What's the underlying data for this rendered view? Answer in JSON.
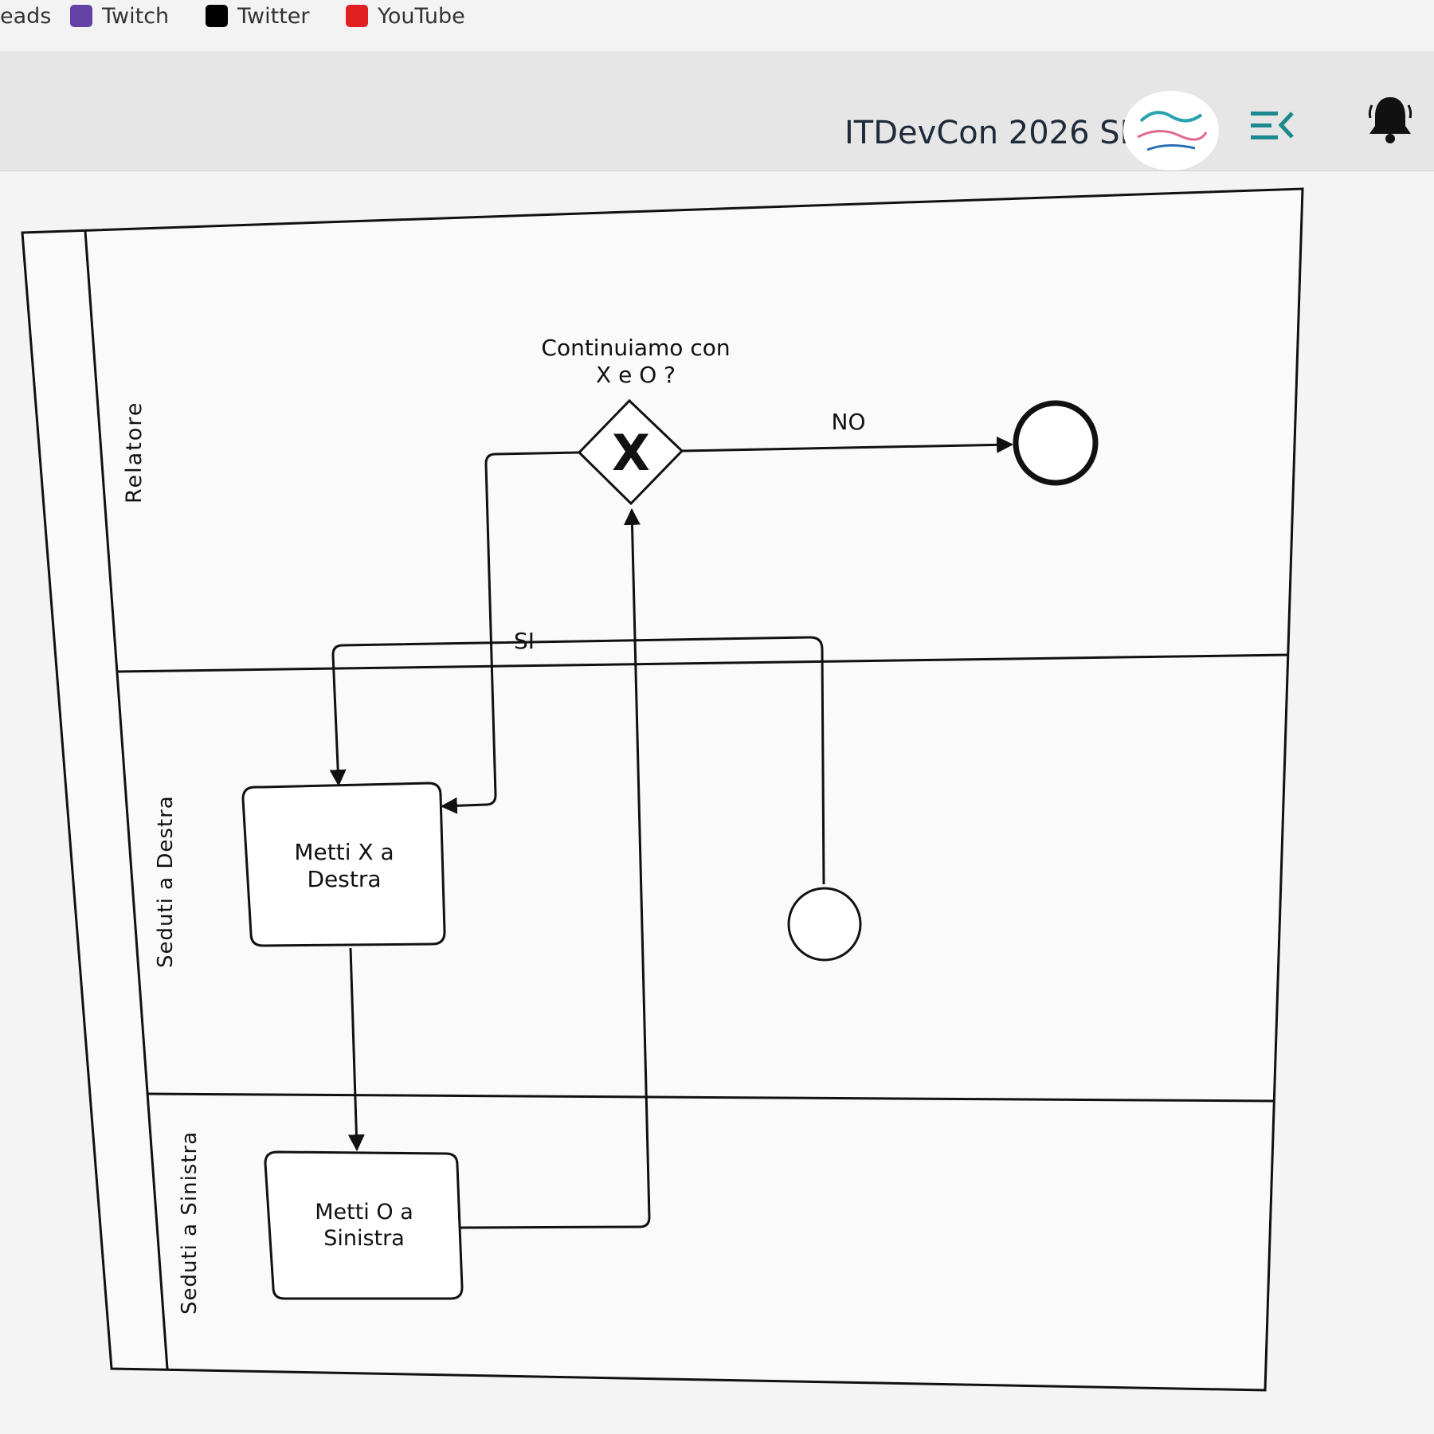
{
  "bookmarks": [
    {
      "label": "eads",
      "color": ""
    },
    {
      "label": "Twitch",
      "color": "#6441a5"
    },
    {
      "label": "Twitter",
      "color": "#000000"
    },
    {
      "label": "YouTube",
      "color": "#e02020"
    }
  ],
  "header": {
    "event_title": "ITDevCon 2026 SE",
    "menu_icon": "menu-collapse-icon",
    "bell_icon": "bell-icon",
    "accent_color": "#1b8a8f"
  },
  "diagram": {
    "lanes": [
      {
        "label": "Relatore"
      },
      {
        "label": "Seduti a Destra"
      },
      {
        "label": "Seduti a Sinistra"
      }
    ],
    "gateway": {
      "label_line1": "Continuiamo con",
      "label_line2": "X e O ?",
      "marker": "X"
    },
    "flow_labels": {
      "no": "NO",
      "si": "SI"
    },
    "tasks": [
      {
        "line1": "Metti X a",
        "line2": "Destra"
      },
      {
        "line1": "Metti O a",
        "line2": "Sinistra"
      }
    ]
  }
}
